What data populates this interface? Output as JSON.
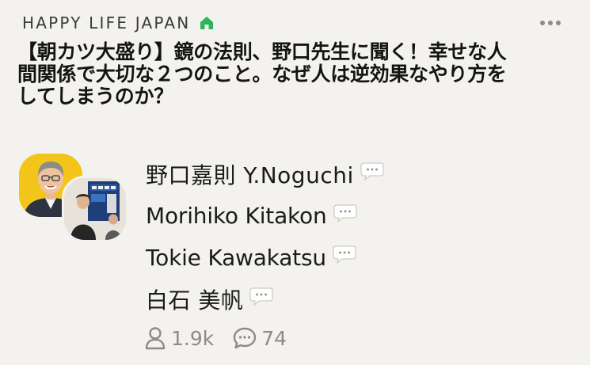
{
  "club": {
    "name": "HAPPY LIFE JAPAN",
    "icon": "home-icon",
    "icon_color": "#2eb45a"
  },
  "room": {
    "title": "【朝カツ大盛り】鏡の法則、野口先生に聞く！幸せな人間関係で大切な２つのこと。なぜ人は逆効果なやり方をしてしまうのか？"
  },
  "menu": {
    "icon": "more-icon"
  },
  "speakers": [
    {
      "name": "野口嘉則 Y.Noguchi",
      "icon": "speech-bubble-icon"
    },
    {
      "name": "Morihiko Kitakon",
      "icon": "speech-bubble-icon"
    },
    {
      "name": "Tokie Kawakatsu",
      "icon": "speech-bubble-icon"
    },
    {
      "name": "白石 美帆",
      "icon": "speech-bubble-icon"
    }
  ],
  "stats": {
    "listeners": "1.9k",
    "speakers_count": "74",
    "listeners_icon": "person-icon",
    "speakers_icon": "chat-icon"
  },
  "colors": {
    "background": "#f3f2ee",
    "avatar_bg": "#f3c51b",
    "muted_text": "#8d8b86"
  }
}
